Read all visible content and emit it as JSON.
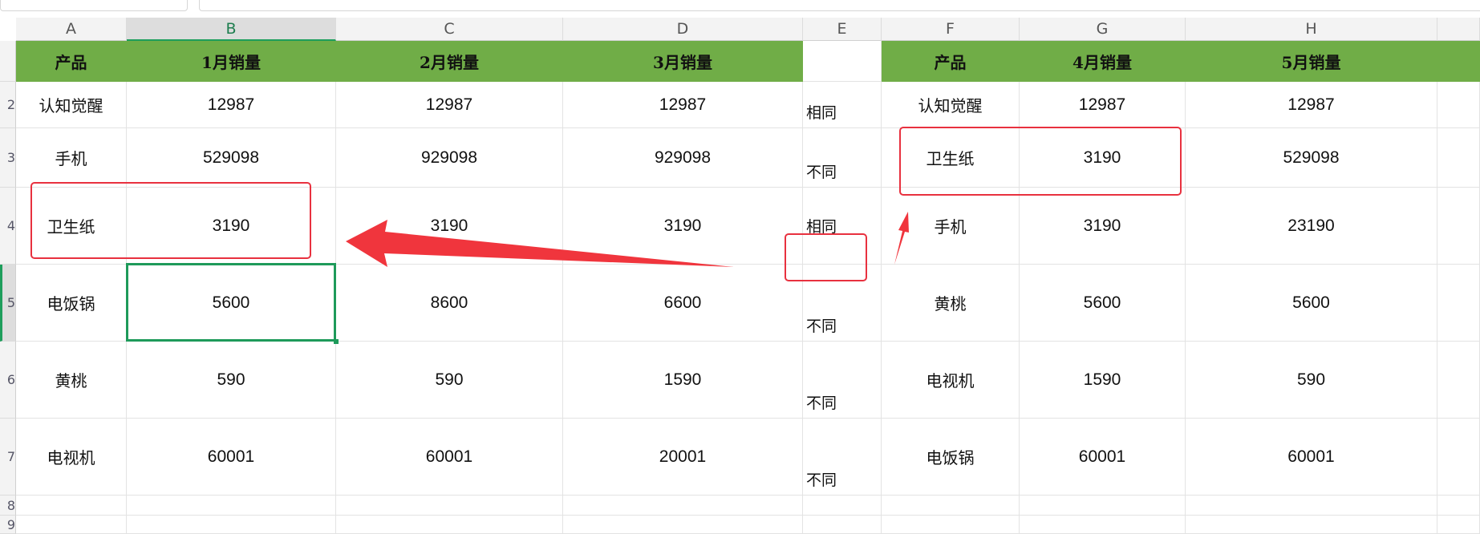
{
  "columns": [
    "A",
    "B",
    "C",
    "D",
    "E",
    "F",
    "G",
    "H"
  ],
  "rows": [
    "2",
    "3",
    "4",
    "5",
    "6",
    "7",
    "8",
    "9"
  ],
  "header_row": {
    "A": "产品",
    "B": "1月销量",
    "C": "2月销量",
    "D": "3月销量",
    "E": "",
    "F": "产品",
    "G": "4月销量",
    "H": "5月销量"
  },
  "left_table": [
    {
      "product": "认知觉醒",
      "m1": "12987",
      "m2": "12987",
      "m3": "12987"
    },
    {
      "product": "手机",
      "m1": "529098",
      "m2": "929098",
      "m3": "929098"
    },
    {
      "product": "卫生纸",
      "m1": "3190",
      "m2": "3190",
      "m3": "3190"
    },
    {
      "product": "电饭锅",
      "m1": "5600",
      "m2": "8600",
      "m3": "6600"
    },
    {
      "product": "黄桃",
      "m1": "590",
      "m2": "590",
      "m3": "1590"
    },
    {
      "product": "电视机",
      "m1": "60001",
      "m2": "60001",
      "m3": "20001"
    }
  ],
  "compare": [
    "相同",
    "不同",
    "相同",
    "不同",
    "不同",
    "不同"
  ],
  "right_table": [
    {
      "product": "认知觉醒",
      "m4": "12987",
      "m5": "12987"
    },
    {
      "product": "卫生纸",
      "m4": "3190",
      "m5": "529098"
    },
    {
      "product": "手机",
      "m4": "3190",
      "m5": "23190"
    },
    {
      "product": "黄桃",
      "m4": "5600",
      "m5": "5600"
    },
    {
      "product": "电视机",
      "m4": "1590",
      "m5": "590"
    },
    {
      "product": "电饭锅",
      "m4": "60001",
      "m5": "60001"
    }
  ],
  "selected_cell": "B6",
  "colors": {
    "header_green": "#70ad47",
    "selection": "#1e9a5a",
    "annotation_red": "#e8313f"
  }
}
